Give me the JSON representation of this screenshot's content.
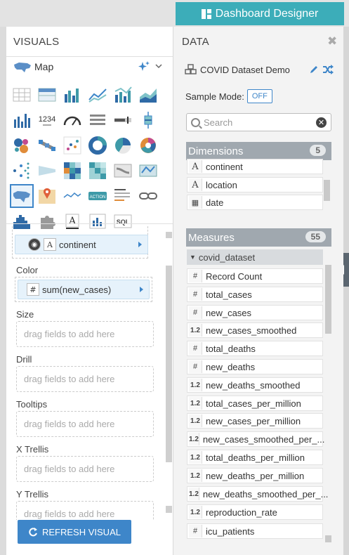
{
  "header": {
    "dashboard_designer_label": "Dashboard Designer"
  },
  "visuals": {
    "title": "VISUALS",
    "selected_type": "Map",
    "fields": {
      "geo_pill": "continent",
      "color_label": "Color",
      "color_pill": "sum(new_cases)",
      "size_label": "Size",
      "drill_label": "Drill",
      "tooltips_label": "Tooltips",
      "xtrellis_label": "X Trellis",
      "ytrellis_label": "Y Trellis",
      "drop_placeholder": "drag fields to add here"
    },
    "grid_icons": [
      "table-icon",
      "cross-tab-icon",
      "grouped-bar-icon",
      "lines-icon",
      "combo-bar-line-icon",
      "areas-icon",
      "bars-icon",
      "kpi-icon",
      "gauge-icon",
      "extension-icon",
      "bullet-icon",
      "box-plot-icon",
      "packed-bubbles-icon",
      "network-icon",
      "scatter-icon",
      "donut-icon",
      "pie-icon",
      "radial-icon",
      "dendrogram-icon",
      "funnel-icon",
      "heatmap-icon",
      "correlation-heatmap-icon",
      "flow-icon",
      "chord-icon",
      "map-icon",
      "interactive-map-icon",
      "sparklines-icon",
      "action-icon",
      "rich-text-icon",
      "chain-link-icon",
      "histogram-icon",
      "extension-puzzle-icon",
      "text-icon",
      "trellis-icon",
      "sql-icon"
    ],
    "grid_labels": {
      "kpi": "1234",
      "action": "ACTION",
      "sql": "SQL"
    },
    "refresh_label": "REFRESH VISUAL"
  },
  "data": {
    "title": "DATA",
    "dataset_name": "COVID Dataset Demo",
    "sample_mode_label": "Sample Mode:",
    "sample_mode_value": "OFF",
    "search_placeholder": "Search",
    "dimensions": {
      "label": "Dimensions",
      "count": "5",
      "items": [
        {
          "type": "A",
          "name": "continent"
        },
        {
          "type": "A",
          "name": "location"
        },
        {
          "type": "cal",
          "name": "date"
        }
      ]
    },
    "measures": {
      "label": "Measures",
      "count": "55",
      "group": "covid_dataset",
      "items": [
        {
          "type": "#",
          "name": "Record Count"
        },
        {
          "type": "#",
          "name": "total_cases"
        },
        {
          "type": "#",
          "name": "new_cases"
        },
        {
          "type": "1.2",
          "name": "new_cases_smoothed"
        },
        {
          "type": "#",
          "name": "total_deaths"
        },
        {
          "type": "#",
          "name": "new_deaths"
        },
        {
          "type": "1.2",
          "name": "new_deaths_smoothed"
        },
        {
          "type": "1.2",
          "name": "total_cases_per_million"
        },
        {
          "type": "1.2",
          "name": "new_cases_per_million"
        },
        {
          "type": "1.2",
          "name": "new_cases_smoothed_per_..."
        },
        {
          "type": "1.2",
          "name": "total_deaths_per_million"
        },
        {
          "type": "1.2",
          "name": "new_deaths_per_million"
        },
        {
          "type": "1.2",
          "name": "new_deaths_smoothed_per_..."
        },
        {
          "type": "1.2",
          "name": "reproduction_rate"
        },
        {
          "type": "#",
          "name": "icu_patients"
        }
      ]
    }
  },
  "colors": {
    "accent": "#3e86c9",
    "teal": "#3cadb9",
    "band": "#a0a8af"
  }
}
